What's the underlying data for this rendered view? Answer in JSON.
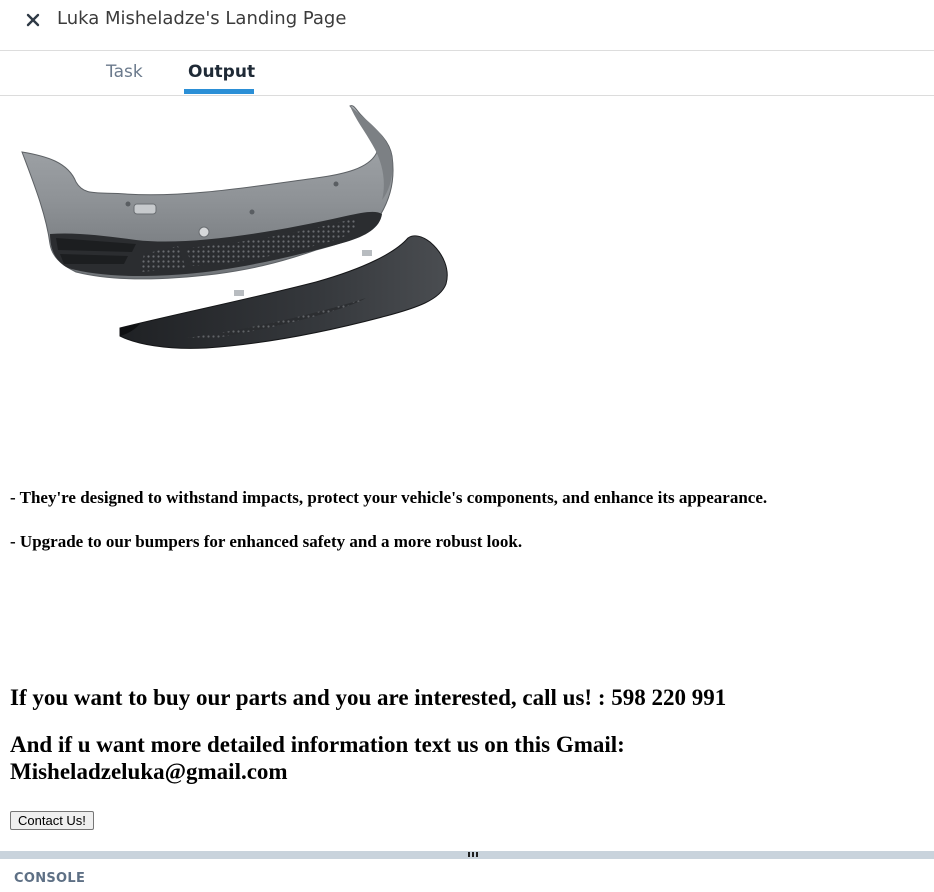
{
  "window": {
    "title": "Luka Misheladze's Landing Page",
    "close_icon": "close-icon"
  },
  "tabs": [
    {
      "label": "Task",
      "active": false
    },
    {
      "label": "Output",
      "active": true
    }
  ],
  "colors": {
    "active_tab_underline": "#2b8fd6",
    "splitter": "#c9d3dc",
    "console_label": "#5e7085"
  },
  "output": {
    "image": "car-front-bumper-image",
    "bullets": [
      "- They're designed to withstand impacts, protect your vehicle's components, and enhance its appearance.",
      "- Upgrade to our bumpers for enhanced safety and a more robust look."
    ],
    "call_text": "If you want to buy our parts and you are interested, call us! : 598 220 991",
    "email_text": "And if u want more detailed information text us on this Gmail: Misheladzeluka@gmail.com",
    "contact_button": "Contact Us!"
  },
  "console": {
    "label": "CONSOLE"
  }
}
